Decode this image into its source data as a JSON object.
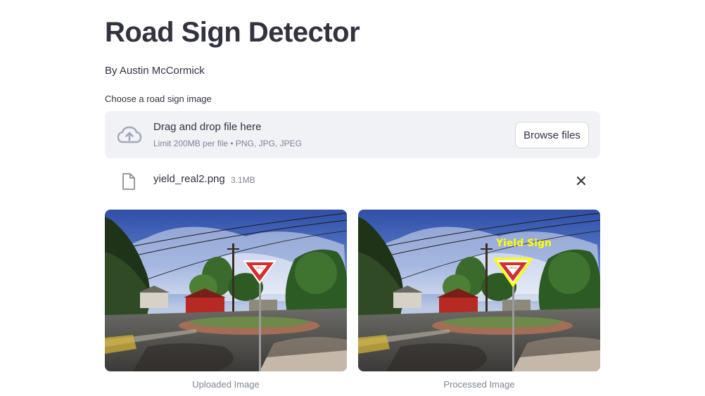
{
  "header": {
    "title": "Road Sign Detector",
    "byline": "By Austin McCormick"
  },
  "uploader": {
    "label": "Choose a road sign image",
    "drop_text": "Drag and drop file here",
    "limit_text": "Limit 200MB per file • PNG, JPG, JPEG",
    "browse_label": "Browse files",
    "upload_icon": "cloud-upload-icon"
  },
  "file": {
    "name": "yield_real2.png",
    "size": "3.1MB",
    "file_icon": "file-icon",
    "remove_icon": "close-icon"
  },
  "images": {
    "uploaded_caption": "Uploaded Image",
    "processed_caption": "Processed Image",
    "detection_label": "Yield Sign"
  },
  "colors": {
    "dropzone_bg": "#f0f2f6",
    "text": "#31333f",
    "muted": "#808495",
    "detection_box": "#ffff00",
    "sign_red": "#d32f2f"
  }
}
